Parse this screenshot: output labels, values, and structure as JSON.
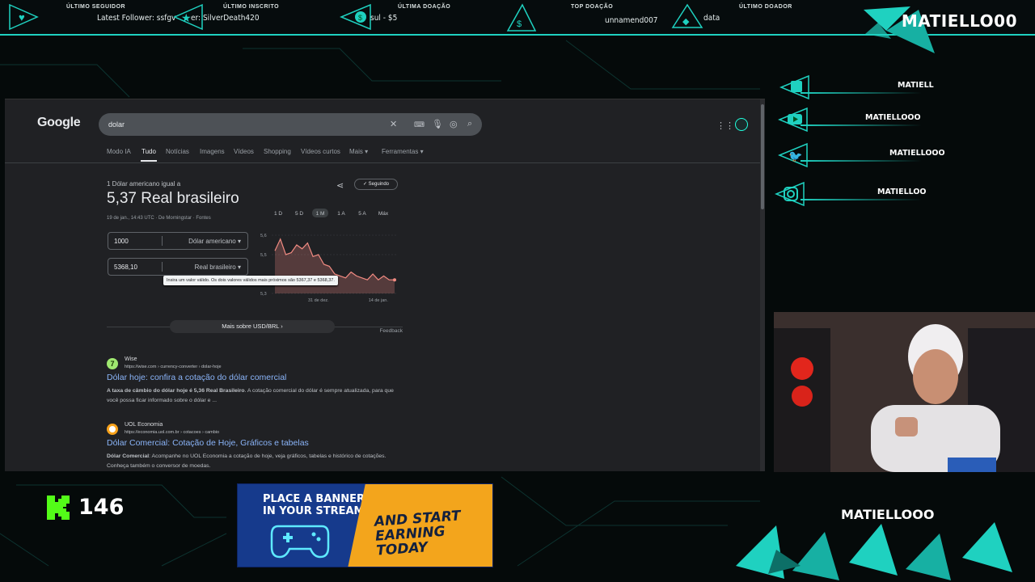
{
  "overlay": {
    "alerts": [
      {
        "label": "Último seguidor",
        "value": "Latest Follower: ssfgv"
      },
      {
        "label": "Último inscrito",
        "value": "er: SilverDeath420"
      },
      {
        "label": "Última doação",
        "value": "sul - $5"
      },
      {
        "label": "Top doação",
        "value": "unnamend007"
      },
      {
        "label": "Último doador",
        "value": "data"
      }
    ],
    "brand_top": "MATIELLO00",
    "socials": [
      {
        "icon": "twitch-icon",
        "label": "MATIELL"
      },
      {
        "icon": "youtube-icon",
        "label": "MATIELLOOO"
      },
      {
        "icon": "twitter-icon",
        "label": "MATIELLOOO"
      },
      {
        "icon": "instagram-icon",
        "label": "MATIELLOO"
      }
    ],
    "brand_bottom": "MATIELLOOO",
    "kick_count": "146",
    "banner": {
      "line1": "PLACE A BANNER\nIN YOUR STREAM",
      "line2": "AND START\nEARNING\nTODAY"
    },
    "accent": "#1fd1c0"
  },
  "browser": {
    "logo": "Google",
    "query": "dolar",
    "tabs": [
      "Modo IA",
      "Tudo",
      "Notícias",
      "Imagens",
      "Vídeos",
      "Shopping",
      "Vídeos curtos",
      "Mais ▾",
      "Ferramentas ▾"
    ],
    "active_tab": "Tudo",
    "converter": {
      "subtitle": "1 Dólar americano igual a",
      "result": "5,37 Real brasileiro",
      "date": "19 de jan., 14:43 UTC · De Morningstar · Fontes",
      "follow": "✓ Seguindo",
      "amount_from": "1000",
      "currency_from": "Dólar americano ▾",
      "amount_to": "5368,10",
      "currency_to": "Real brasileiro ▾",
      "tooltip": "Insira um valor válido. Os dois valores válidos mais próximos são 5367,37 e 5368,37.",
      "range_buttons": [
        "1 D",
        "5 D",
        "1 M",
        "1 A",
        "5 A",
        "Máx"
      ],
      "active_range": "1 M",
      "more_button": "Mais sobre USD/BRL  ›",
      "feedback": "Feedback"
    },
    "results": [
      {
        "site": "Wise",
        "url": "https://wise.com › currency-converter › dolar-hoje",
        "title": "Dólar hoje: confira a cotação do dólar comercial",
        "snippet_bold": "A taxa de câmbio do dólar hoje é 5,36 Real Brasileiro",
        "snippet": ". A cotação comercial do dólar é sempre atualizada, para que você possa ficar informado sobre o dólar e ..."
      },
      {
        "site": "UOL Economia",
        "url": "https://economia.uol.com.br › cotacoes › cambio",
        "title": "Dólar Comercial: Cotação de Hoje, Gráficos e tabelas",
        "snippet_bold": "Dólar Comercial",
        "snippet": ": Acompanhe no UOL Economia a cotação de hoje, veja gráficos, tabelas e histórico de cotações. Conheça também o conversor de moedas."
      }
    ]
  },
  "chart_data": {
    "type": "area",
    "y_ticks": [
      "5,6",
      "5,5",
      "5,3"
    ],
    "x_ticks": [
      "31 de dez.",
      "14 de jan."
    ],
    "ylim": [
      5.3,
      5.6
    ],
    "values": [
      5.52,
      5.58,
      5.5,
      5.51,
      5.55,
      5.53,
      5.56,
      5.49,
      5.5,
      5.45,
      5.44,
      5.4,
      5.39,
      5.38,
      5.41,
      5.39,
      5.38,
      5.37,
      5.4,
      5.37,
      5.39,
      5.37,
      5.37
    ]
  }
}
